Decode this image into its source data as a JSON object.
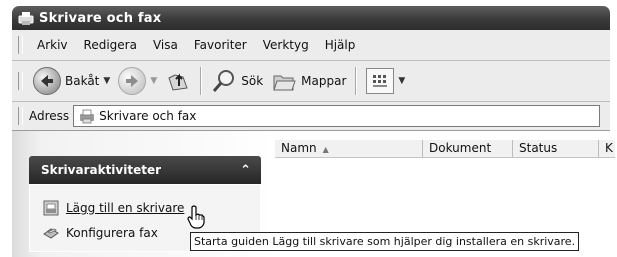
{
  "window": {
    "title": "Skrivare och fax",
    "title_icon": "printers-fax-folder-icon"
  },
  "menubar": {
    "items": [
      "Arkiv",
      "Redigera",
      "Visa",
      "Favoriter",
      "Verktyg",
      "Hjälp"
    ]
  },
  "toolbar": {
    "back_label": "Bakåt",
    "search_label": "Sök",
    "folders_label": "Mappar"
  },
  "address": {
    "label": "Adress",
    "value": "Skrivare och fax"
  },
  "columns": [
    {
      "label": "Namn",
      "sorted": true
    },
    {
      "label": "Dokument"
    },
    {
      "label": "Status"
    },
    {
      "label": "K"
    }
  ],
  "task_panel": {
    "title": "Skrivaraktiviteter",
    "collapse_glyph": "⌃",
    "items": [
      {
        "label": "Lägg till en skrivare",
        "icon": "add-printer-icon",
        "hovered": true
      },
      {
        "label": "Konfigurera fax",
        "icon": "fax-icon"
      }
    ]
  },
  "tooltip": {
    "text": "Starta guiden Lägg till skrivare som hjälper dig installera en skrivare."
  }
}
